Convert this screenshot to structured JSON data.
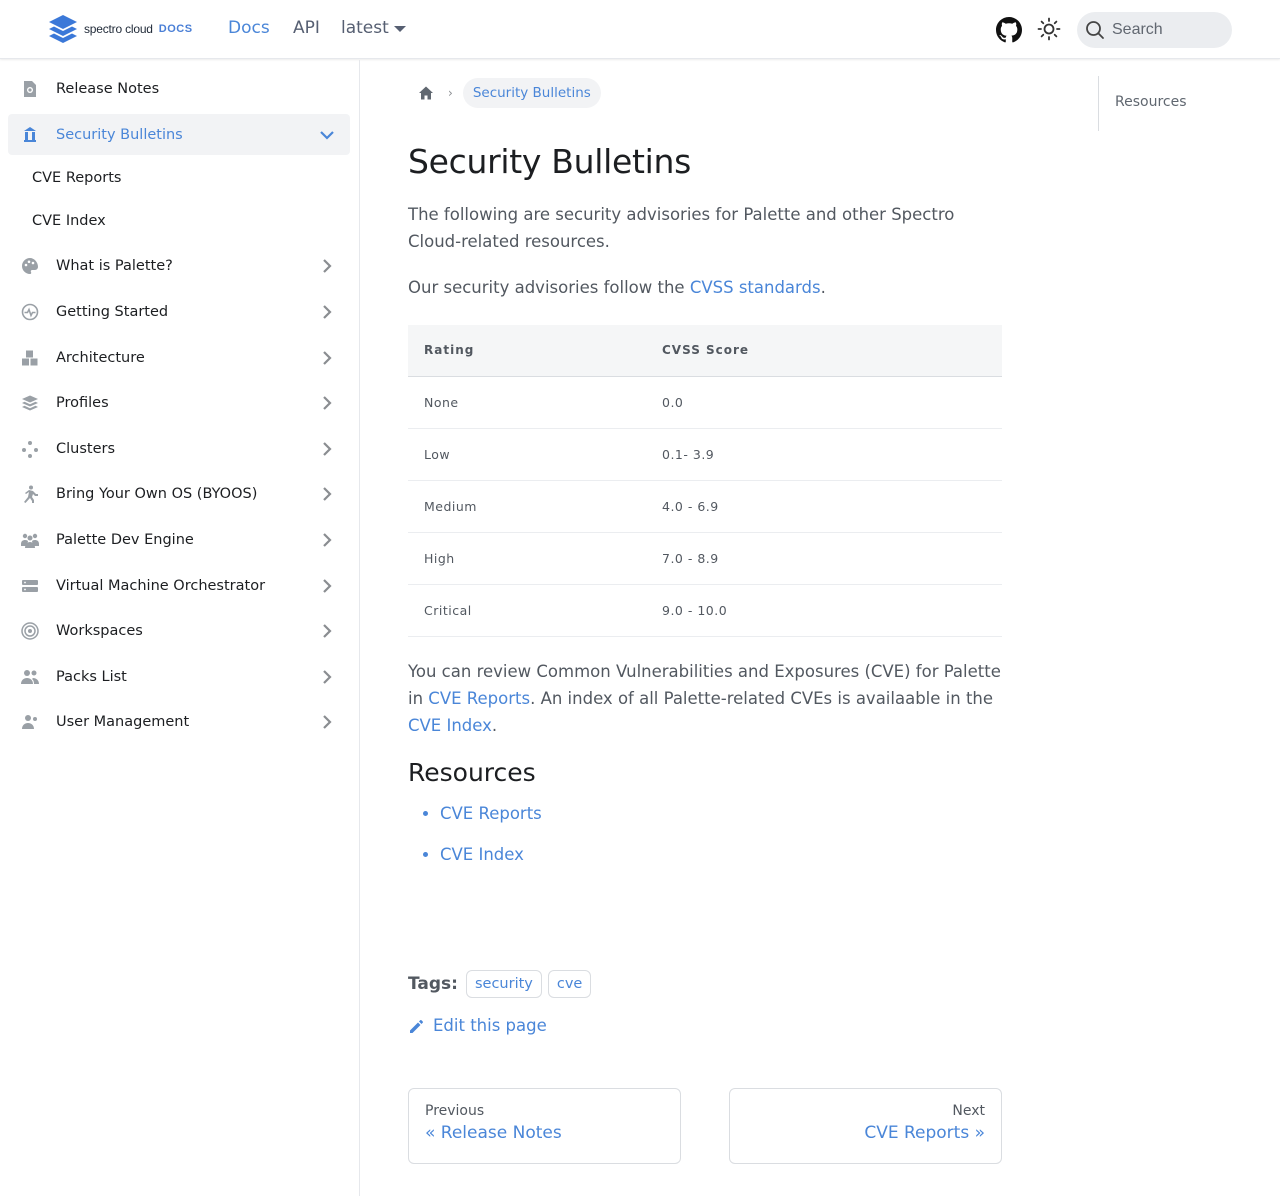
{
  "navbar": {
    "logo_text": "spectro cloud",
    "logo_badge": "DOCS",
    "links": [
      {
        "label": "Docs"
      },
      {
        "label": "API"
      }
    ],
    "version": "latest",
    "search_placeholder": "Search"
  },
  "sidebar": {
    "items": [
      {
        "label": "Release Notes",
        "icon": "document-search-icon"
      },
      {
        "label": "Security Bulletins",
        "icon": "shield-building-icon"
      },
      {
        "label": "CVE Reports"
      },
      {
        "label": "CVE Index"
      },
      {
        "label": "What is Palette?",
        "icon": "palette-icon"
      },
      {
        "label": "Getting Started",
        "icon": "pulse-icon"
      },
      {
        "label": "Architecture",
        "icon": "cubes-icon"
      },
      {
        "label": "Profiles",
        "icon": "stack-icon"
      },
      {
        "label": "Clusters",
        "icon": "nodes-icon"
      },
      {
        "label": "Bring Your Own OS (BYOOS)",
        "icon": "person-walking-icon"
      },
      {
        "label": "Palette Dev Engine",
        "icon": "users-icon"
      },
      {
        "label": "Virtual Machine Orchestrator",
        "icon": "server-icon"
      },
      {
        "label": "Workspaces",
        "icon": "target-icon"
      },
      {
        "label": "Packs List",
        "icon": "people-icon"
      },
      {
        "label": "User Management",
        "icon": "user-icon"
      }
    ]
  },
  "breadcrumb": {
    "current": "Security Bulletins"
  },
  "page": {
    "title": "Security Bulletins",
    "intro": "The following are security advisories for Palette and other Spectro Cloud-related resources.",
    "cvss_prefix": "Our security advisories follow the ",
    "cvss_link": "CVSS standards",
    "cvss_suffix": ".",
    "table": {
      "headers": [
        "Rating",
        "CVSS Score"
      ],
      "rows": [
        [
          "None",
          "0.0"
        ],
        [
          "Low",
          "0.1- 3.9"
        ],
        [
          "Medium",
          "4.0 - 6.9"
        ],
        [
          "High",
          "7.0 - 8.9"
        ],
        [
          "Critical",
          "9.0 - 10.0"
        ]
      ]
    },
    "review_prefix": "You can review Common Vulnerabilities and Exposures (CVE) for Palette in ",
    "review_link1": "CVE Reports",
    "review_mid": ". An index of all Palette-related CVEs is availaable in the ",
    "review_link2": "CVE Index",
    "review_suffix": ".",
    "resources_heading": "Resources",
    "resources": [
      "CVE Reports",
      "CVE Index"
    ],
    "tags_label": "Tags:",
    "tags": [
      "security",
      "cve"
    ],
    "edit_label": "Edit this page",
    "prev_sub": "Previous",
    "prev_label": "« Release Notes",
    "next_sub": "Next",
    "next_label": "CVE Reports »"
  },
  "toc": {
    "items": [
      "Resources"
    ]
  },
  "colors": {
    "accent": "#4a86d8",
    "text": "#1c1e21",
    "muted": "#525860"
  }
}
